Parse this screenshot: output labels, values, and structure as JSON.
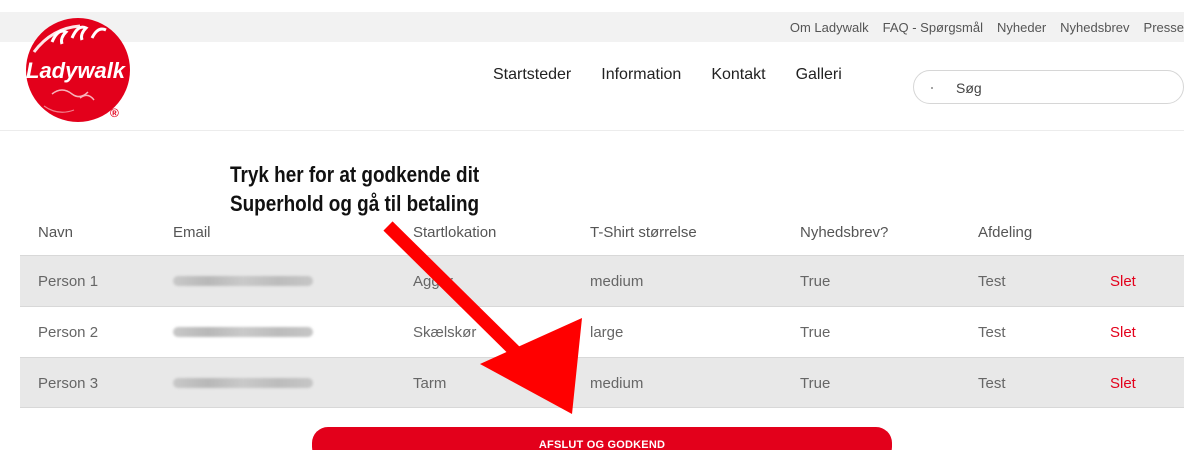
{
  "top_links": [
    "Om Ladywalk",
    "FAQ - Spørgsmål",
    "Nyheder",
    "Nyhedsbrev",
    "Presse"
  ],
  "logo": {
    "text": "Ladywalk",
    "mark": "®",
    "color": "#e3001b"
  },
  "main_nav": [
    "Startsteder",
    "Information",
    "Kontakt",
    "Galleri"
  ],
  "search": {
    "placeholder": "Søg",
    "value": ""
  },
  "annotation": {
    "line1": "Tryk her for at godkende dit",
    "line2": "Superhold og gå til betaling",
    "arrow_color": "#ff0000"
  },
  "table": {
    "headers": [
      "Navn",
      "Email",
      "Startlokation",
      "T-Shirt størrelse",
      "Nyhedsbrev?",
      "Afdeling",
      ""
    ],
    "rows": [
      {
        "name": "Person 1",
        "email": "",
        "location": "Agger",
        "shirt": "medium",
        "newsletter": "True",
        "department": "Test",
        "action": "Slet"
      },
      {
        "name": "Person 2",
        "email": "",
        "location": "Skælskør",
        "shirt": "large",
        "newsletter": "True",
        "department": "Test",
        "action": "Slet"
      },
      {
        "name": "Person 3",
        "email": "",
        "location": "Tarm",
        "shirt": "medium",
        "newsletter": "True",
        "department": "Test",
        "action": "Slet"
      }
    ]
  },
  "submit_label": "AFSLUT OG GODKEND",
  "colors": {
    "brand_red": "#e3001b",
    "row_shade": "#e8e8e8",
    "topbar": "#f2f2f2"
  }
}
